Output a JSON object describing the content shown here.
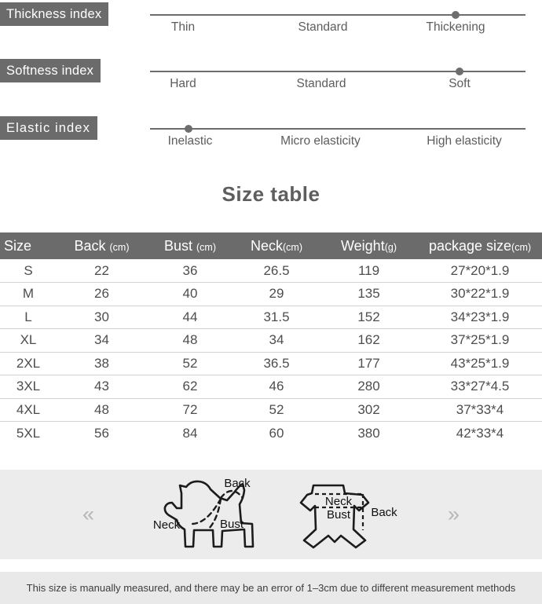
{
  "indices": [
    {
      "name": "thickness-index",
      "label": "Thickness index",
      "ticks": [
        "Thin",
        "Standard",
        "Thickening"
      ],
      "selected_index": 2,
      "selected_value": "Thickening"
    },
    {
      "name": "softness-index",
      "label": "Softness index",
      "ticks": [
        "Hard",
        "Standard",
        "Soft"
      ],
      "selected_index": 2,
      "selected_value": "Soft"
    },
    {
      "name": "elastic-index",
      "label": "Elastic index",
      "ticks": [
        "Inelastic",
        "Micro elasticity",
        "High elasticity"
      ],
      "selected_index": 0,
      "selected_value": "Inelastic"
    }
  ],
  "table": {
    "title": "Size table",
    "columns": [
      {
        "label": "Size",
        "unit": ""
      },
      {
        "label": "Back",
        "unit": "(cm)"
      },
      {
        "label": "Bust",
        "unit": "(cm)"
      },
      {
        "label": "Neck",
        "unit": "(cm)"
      },
      {
        "label": "Weight",
        "unit": "(g)"
      },
      {
        "label": "package size",
        "unit": "(cm)"
      }
    ],
    "rows": [
      {
        "size": "S",
        "back": "22",
        "bust": "36",
        "neck": "26.5",
        "weight": "119",
        "package": "27*20*1.9"
      },
      {
        "size": "M",
        "back": "26",
        "bust": "40",
        "neck": "29",
        "weight": "135",
        "package": "30*22*1.9"
      },
      {
        "size": "L",
        "back": "30",
        "bust": "44",
        "neck": "31.5",
        "weight": "152",
        "package": "34*23*1.9"
      },
      {
        "size": "XL",
        "back": "34",
        "bust": "48",
        "neck": "34",
        "weight": "162",
        "package": "37*25*1.9"
      },
      {
        "size": "2XL",
        "back": "38",
        "bust": "52",
        "neck": "36.5",
        "weight": "177",
        "package": "43*25*1.9"
      },
      {
        "size": "3XL",
        "back": "43",
        "bust": "62",
        "neck": "46",
        "weight": "280",
        "package": "33*27*4.5"
      },
      {
        "size": "4XL",
        "back": "48",
        "bust": "72",
        "neck": "52",
        "weight": "302",
        "package": "37*33*4"
      },
      {
        "size": "5XL",
        "back": "56",
        "bust": "84",
        "neck": "60",
        "weight": "380",
        "package": "42*33*4"
      }
    ]
  },
  "diagram": {
    "prev_arrow": "«",
    "next_arrow": "»",
    "dog": {
      "name": "dog-measurement-diagram",
      "labels": {
        "neck": "Neck",
        "bust": "Bust",
        "back": "Back"
      }
    },
    "garment": {
      "name": "garment-measurement-diagram",
      "labels": {
        "neck": "Neck",
        "bust": "Bust",
        "back": "Back"
      }
    }
  },
  "footer": {
    "note": "This size is manually measured, and there may be an error of 1–3cm due to different measurement methods"
  },
  "colors": {
    "badge_bg": "#6b6b6b",
    "header_bg": "#6b6b6b",
    "panel_bg": "#ececec",
    "footer_bg": "#e9e9e9",
    "line": "#6d6d6d",
    "text": "#4d4d4d"
  }
}
